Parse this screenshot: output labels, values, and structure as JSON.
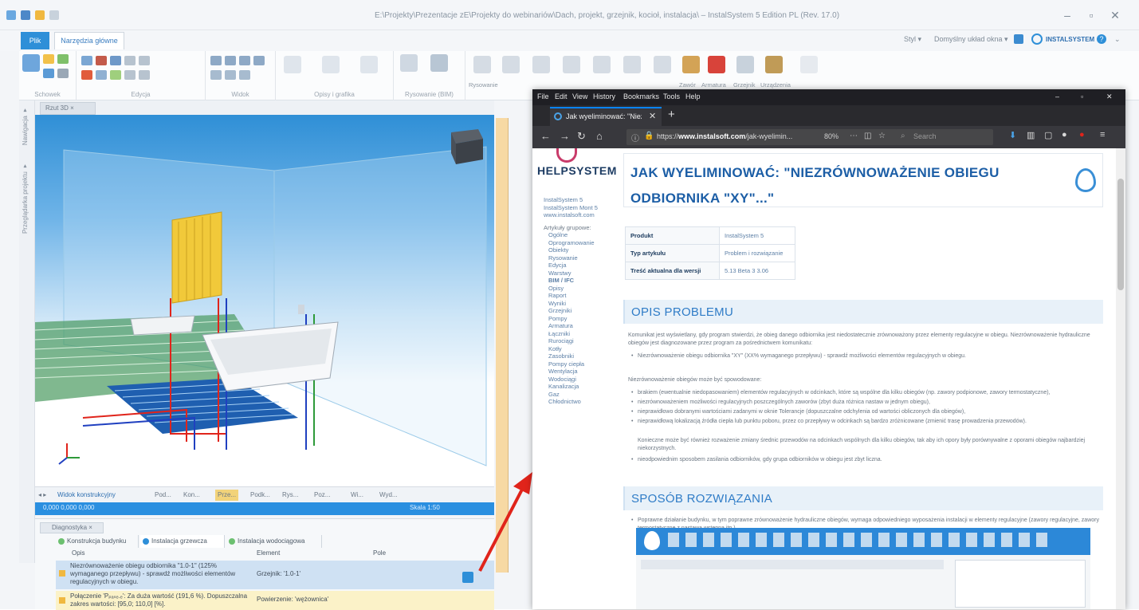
{
  "app": {
    "window_title": "E:\\Projekty\\Prezentacje zE\\Projekty do webinariów\\Dach, projekt, grzejnik, kocioł, instalacja\\ – InstalSystem 5 Edition PL (Rev. 17.0)",
    "tabs": {
      "file": "Plik",
      "main": "Narzędzia główne"
    },
    "right_items": {
      "style": "Styl ▾",
      "style_set": "Domyślny układ okna ▾",
      "brand": "INSTALSYSTEM"
    },
    "ribbon_groups": [
      "Schowek",
      "Edycja",
      "Widok",
      "Opisy i grafika",
      "Rysowanie (BIM)"
    ],
    "ribbon_labels": [
      "Rysowanie",
      "Armatura",
      "Zawór",
      "Grzejnik",
      "Urządzenia"
    ],
    "left_tabs": [
      "Nawigacja ▾",
      "Przeglądarka projektu ▾"
    ],
    "viewport_tab": "Rzut 3D ×",
    "bottom_tabs": [
      "Widok konstrukcyjny",
      "Pod...",
      "Kon...",
      "Prze...",
      "Podk...",
      "Rys...",
      "Poz...",
      "Wi...",
      "Wyd..."
    ],
    "status_left": "0,000  0,000  0,000",
    "status_right": "Skala 1:50",
    "diagnostics": {
      "title": "Diagnostyka ×",
      "tabs": [
        "Konstrukcja budynku",
        "Instalacja grzewcza",
        "Instalacja wodociągowa"
      ],
      "columns": [
        "Opis",
        "Element",
        "Pole"
      ],
      "rows": [
        {
          "desc": "Niezrównoważenie obiegu odbiornika \"1.0-1\" (125% wymaganego przepływu) - sprawdź możliwości elementów regulacyjnych w obiegu.",
          "element": "Grzejnik: '1.0-1'"
        },
        {
          "desc": "Połączenie 'Pₚₐₛₑ.ₑ': Za duża wartość (191,6 %). Dopuszczalna zakres wartości: [95,0; 110,0] [%].",
          "element": "Powierzenie: 'wężownica'"
        }
      ]
    }
  },
  "browser": {
    "menu": [
      "File",
      "Edit",
      "View",
      "History",
      "Bookmarks",
      "Tools",
      "Help"
    ],
    "tab_title": "Jak wyeliminować: \"Niezrów...",
    "url_prefix": "https://",
    "url_domain": "www.instalsoft.com",
    "url_rest": "/jak-wyelimin...",
    "zoom": "80%",
    "search_placeholder": "Search",
    "page": {
      "logo_text": "HELPSYSTEM",
      "side_links": [
        "InstalSystem 5",
        "InstalSystem Mont 5",
        "www.instalsoft.com",
        "",
        "Artykuły grupowe:",
        "Ogólne",
        "Oprogramowanie",
        "Obiekty",
        "Rysowanie",
        "Edycja",
        "Warstwy",
        "BIM / IFC",
        "Opisy",
        "Raport",
        "Wyniki",
        "Grzejniki",
        "Pompy",
        "Armatura",
        "Łączniki",
        "Rurociągi",
        "Kotły",
        "Zasobniki",
        "Pompy ciepła",
        "Wentylacja",
        "Wodociągi",
        "Kanalizacja",
        "Gaz",
        "Chłodnictwo"
      ],
      "title": "JAK WYELIMINOWAĆ: \"NIEZRÓWNOWAŻENIE OBIEGU ODBIORNIKA \"XY\"...\"",
      "info_table": [
        {
          "key": "Produkt",
          "value": "InstalSystem 5"
        },
        {
          "key": "Typ artykułu",
          "value": "Problem i rozwiązanie"
        },
        {
          "key": "Treść aktualna dla wersji",
          "value": "5.13 Beta 3 3.06"
        }
      ],
      "section1": "OPIS PROBLEMU",
      "section1_intro": "Komunikat jest wyświetlany, gdy program stwierdzi, że obieg danego odbiornika jest niedostatecznie zrównoważony przez elementy regulacyjne w obiegu. Niezrównoważenie hydrauliczne obiegów jest diagnozowane przez program za pośrednictwem komunikatu:",
      "section1_bullet": "Niezrównoważenie obiegu odbiornika \"XY\" (XX% wymaganego przepływu) - sprawdź możliwości elementów regulacyjnych w obiegu.",
      "causes_intro": "Niezrównoważenie obiegów może być spowodowane:",
      "causes": [
        "brakiem (ewentualnie niedopasowaniem) elementów regulacyjnych w odcinkach, które są wspólne dla kilku obiegów (np. zawory podpionowe, zawory termostatyczne),",
        "niezrównoważeniem możliwości regulacyjnych poszczególnych zaworów (zbyt duża różnica nastaw w jednym obiegu),",
        "nieprawidłowo dobranymi wartościami zadanymi w oknie Tolerancje (dopuszczalne odchylenia od wartości obliczonych dla obiegów),",
        "nieprawidłową lokalizacją źródła ciepła lub punktu poboru, przez co przepływy w odcinkach są bardzo zróżnicowane (zmienić trasę prowadzenia przewodów).",
        "Konieczne może być również rozważenie zmiany średnic przewodów na odcinkach wspólnych dla kilku obiegów, tak aby ich opory były porównywalne z oporami obiegów najbardziej niekorzystnych.",
        "nieodpowiednim sposobem zasilania odbiorników, gdy grupa odbiorników w obiegu jest zbyt liczna."
      ],
      "section2": "SPOSÓB ROZWIĄZANIA",
      "section2_bullet": "Poprawne działanie budynku, w tym poprawne zrównoważenie hydrauliczne obiegów, wymaga odpowiedniego wyposażenia instalacji w elementy regulacyjne (zawory regulacyjne, zawory termostatyczne z nastawą wstępną itp.)."
    }
  },
  "colors": {
    "accent_blue": "#2e8fd8",
    "title_blue": "#1c5ea6",
    "arrow_red": "#e0241b",
    "viewport_sky": "#2f8fd6"
  }
}
